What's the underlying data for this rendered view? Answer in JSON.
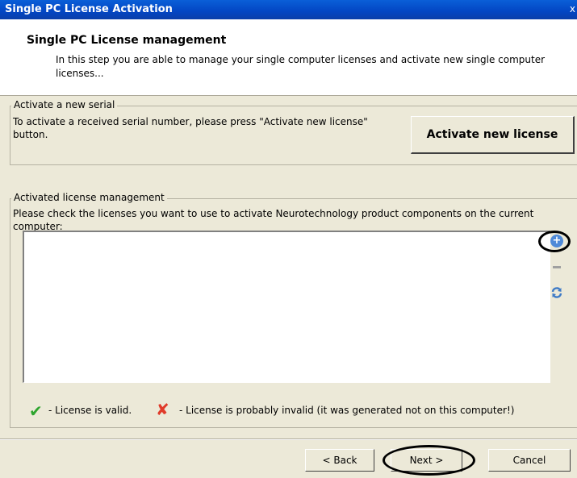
{
  "window": {
    "title": "Single PC License Activation",
    "close_glyph": "x"
  },
  "header": {
    "title": "Single PC License management",
    "description": "In this step you are able to manage your single computer licenses and activate new single computer licenses..."
  },
  "activate_group": {
    "legend": "Activate a new serial",
    "text": "To activate a received serial number, please press \"Activate new license\" button.",
    "button_label": "Activate new license"
  },
  "management_group": {
    "legend": "Activated license management",
    "text": "Please check the licenses you want to use to activate Neurotechnology product components on the current computer:",
    "licenses": [],
    "side_buttons": {
      "add_glyph": "+",
      "remove_icon": "minus-icon",
      "refresh_icon": "refresh-icon"
    },
    "legend_items": {
      "valid_glyph": "✔",
      "valid_text": "- License is valid.",
      "invalid_glyph": "✘",
      "invalid_text": "- License is probably invalid (it was generated not on this computer!)"
    }
  },
  "footer": {
    "back_label": "< Back",
    "next_label": "Next >",
    "cancel_label": "Cancel"
  },
  "colors": {
    "dialog_bg": "#ece9d8",
    "titlebar": "#0346c3",
    "valid": "#2ea52e",
    "invalid": "#e03b2a",
    "add_button": "#4f8ad8"
  }
}
